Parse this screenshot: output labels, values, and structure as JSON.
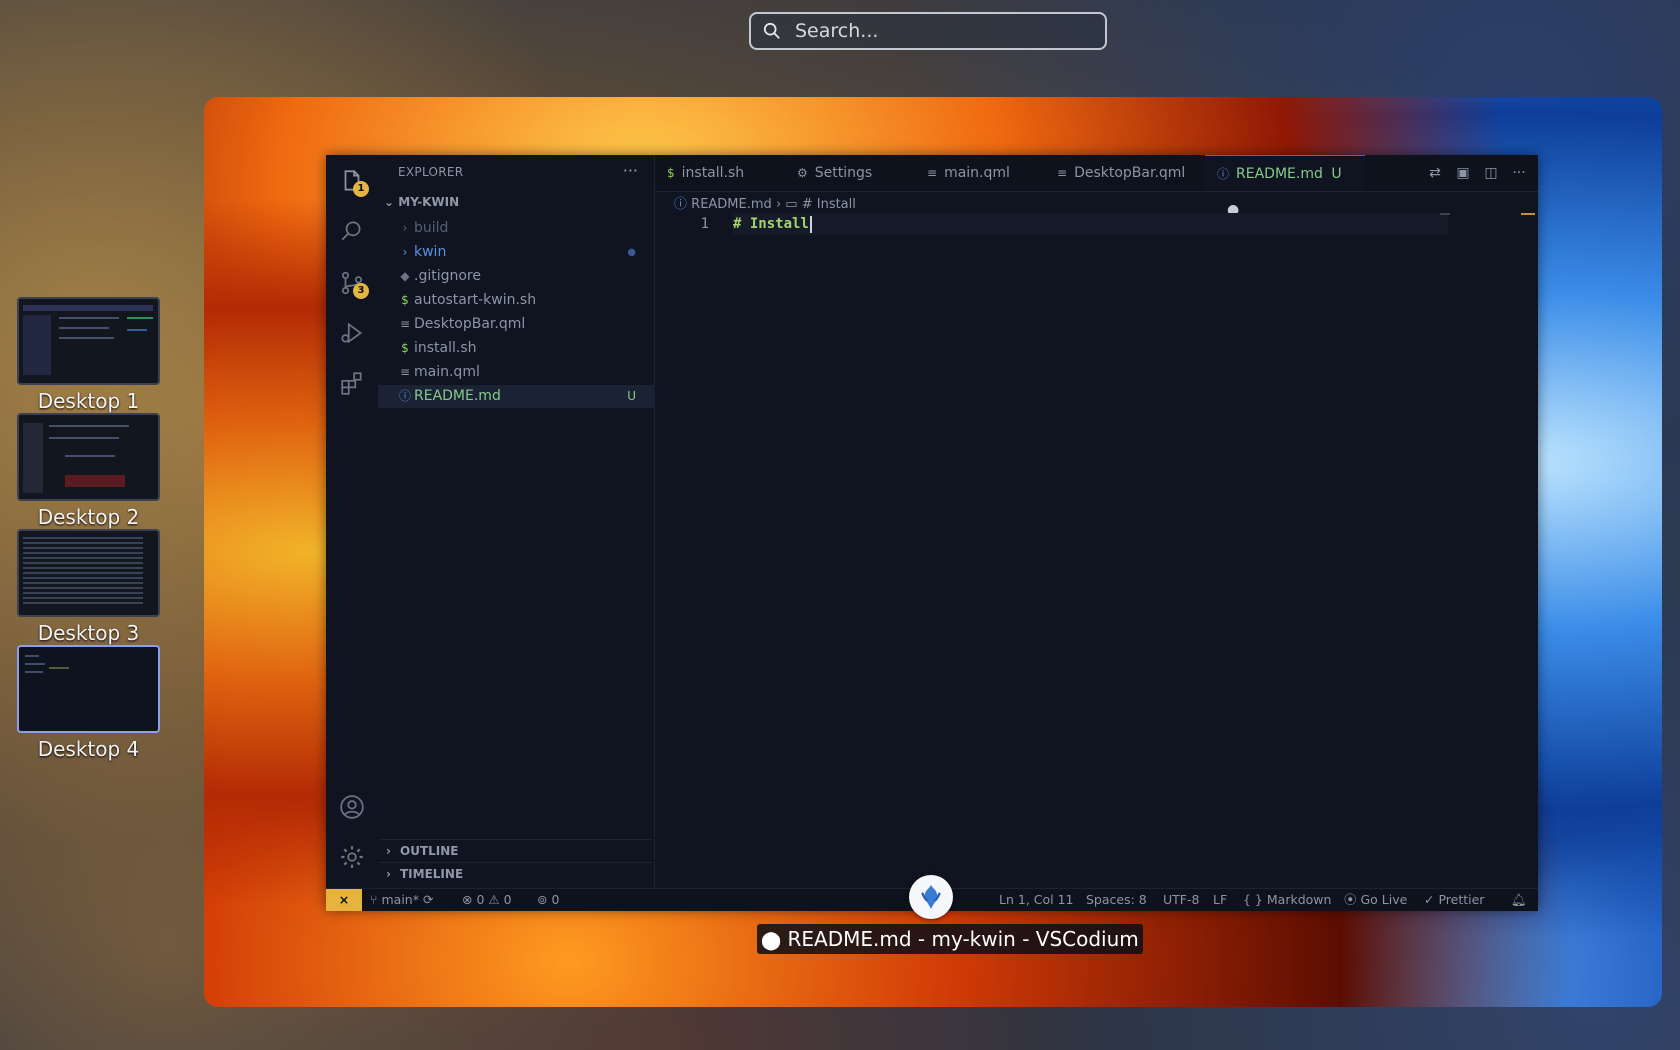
{
  "search": {
    "placeholder": "Search..."
  },
  "desktops": [
    {
      "label": "Desktop 1",
      "active": false
    },
    {
      "label": "Desktop 2",
      "active": false
    },
    {
      "label": "Desktop 3",
      "active": false
    },
    {
      "label": "Desktop 4",
      "active": true
    }
  ],
  "vscode": {
    "activity": {
      "explorer_badge": "1",
      "scm_badge": "3"
    },
    "sidebar": {
      "title": "EXPLORER",
      "more": "···",
      "root": "MY-KWIN",
      "items": [
        {
          "label": "build",
          "type": "folder",
          "dim": true
        },
        {
          "label": "kwin",
          "type": "folder",
          "decoration": "●"
        },
        {
          "label": ".gitignore",
          "type": "git"
        },
        {
          "label": "autostart-kwin.sh",
          "type": "shell"
        },
        {
          "label": "DesktopBar.qml",
          "type": "text"
        },
        {
          "label": "install.sh",
          "type": "shell"
        },
        {
          "label": "main.qml",
          "type": "text"
        },
        {
          "label": "README.md",
          "type": "info",
          "decoration": "U",
          "selected": true
        }
      ],
      "sections": [
        "OUTLINE",
        "TIMELINE"
      ]
    },
    "tabs": [
      {
        "label": "install.sh",
        "icon": "$"
      },
      {
        "label": "Settings",
        "icon": "⚙"
      },
      {
        "label": "main.qml",
        "icon": "≡"
      },
      {
        "label": "DesktopBar.qml",
        "icon": "≡"
      },
      {
        "label": "README.md",
        "icon": "ⓘ",
        "active": true,
        "status": "U",
        "dirty": "●"
      }
    ],
    "breadcrumb": {
      "file": "README.md",
      "symbol": "# Install"
    },
    "editor": {
      "line_number": "1",
      "line": "# Install"
    },
    "status": {
      "branch": "main*",
      "errors": "0",
      "warnings": "0",
      "ports": "0",
      "position": "Ln 1, Col 11",
      "spaces": "Spaces: 8",
      "encoding": "UTF-8",
      "eol": "LF",
      "language": "Markdown",
      "golive": "Go Live",
      "prettier": "Prettier"
    }
  },
  "window_caption": "README.md - my-kwin - VSCodium"
}
